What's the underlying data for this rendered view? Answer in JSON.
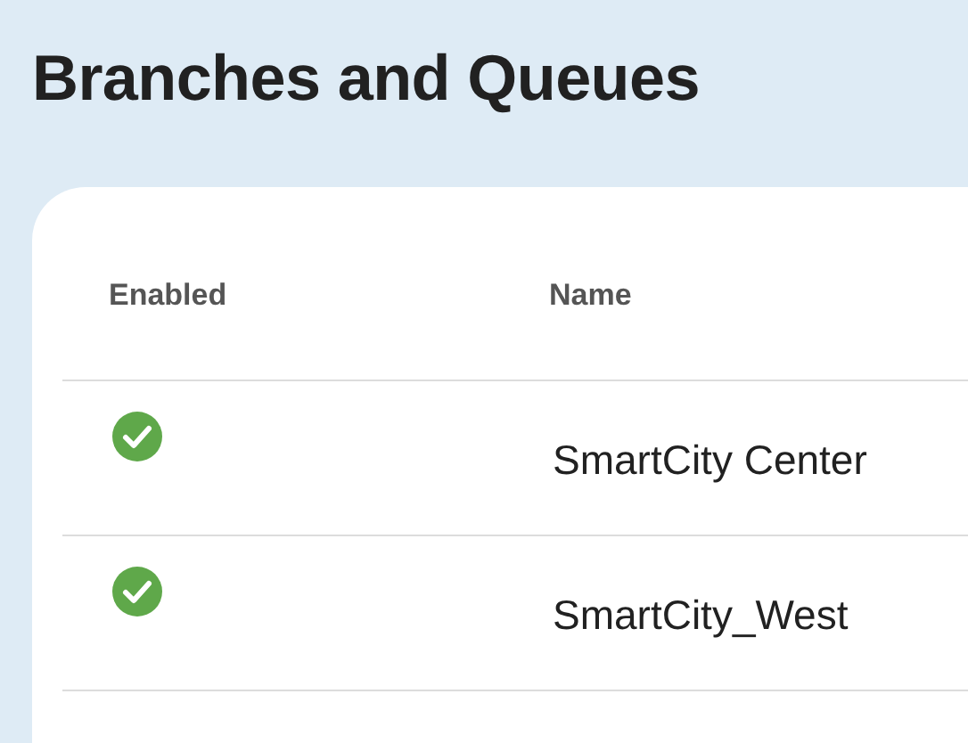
{
  "page": {
    "title": "Branches and Queues"
  },
  "table": {
    "columns": [
      "Enabled",
      "Name"
    ],
    "rows": [
      {
        "enabled": true,
        "name": "SmartCity Center"
      },
      {
        "enabled": true,
        "name": "SmartCity_West"
      }
    ]
  }
}
